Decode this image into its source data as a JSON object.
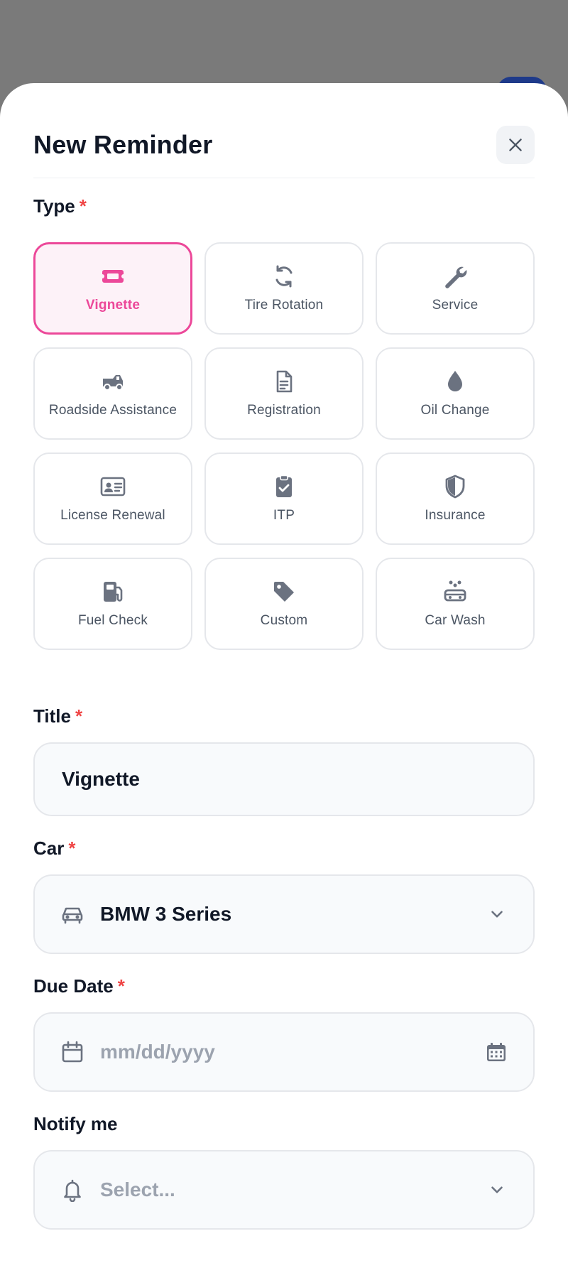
{
  "modal": {
    "title": "New Reminder"
  },
  "type_section": {
    "label": "Type",
    "required_mark": "*",
    "options": [
      {
        "label": "Vignette",
        "icon": "ticket-icon",
        "selected": true
      },
      {
        "label": "Tire Rotation",
        "icon": "rotate-icon",
        "selected": false
      },
      {
        "label": "Service",
        "icon": "wrench-icon",
        "selected": false
      },
      {
        "label": "Roadside Assistance",
        "icon": "tow-truck-icon",
        "selected": false
      },
      {
        "label": "Registration",
        "icon": "document-icon",
        "selected": false
      },
      {
        "label": "Oil Change",
        "icon": "droplet-icon",
        "selected": false
      },
      {
        "label": "License Renewal",
        "icon": "id-card-icon",
        "selected": false
      },
      {
        "label": "ITP",
        "icon": "clipboard-check-icon",
        "selected": false
      },
      {
        "label": "Insurance",
        "icon": "shield-icon",
        "selected": false
      },
      {
        "label": "Fuel Check",
        "icon": "fuel-pump-icon",
        "selected": false
      },
      {
        "label": "Custom",
        "icon": "tag-icon",
        "selected": false
      },
      {
        "label": "Car Wash",
        "icon": "car-wash-icon",
        "selected": false
      }
    ]
  },
  "title_field": {
    "label": "Title",
    "required_mark": "*",
    "value": "Vignette"
  },
  "car_field": {
    "label": "Car",
    "required_mark": "*",
    "value": "BMW 3 Series",
    "icon": "car-icon"
  },
  "due_date_field": {
    "label": "Due Date",
    "required_mark": "*",
    "placeholder": "mm/dd/yyyy",
    "icon": "calendar-icon"
  },
  "notify_field": {
    "label": "Notify me",
    "placeholder": "Select...",
    "icon": "bell-icon"
  },
  "colors": {
    "accent": "#ec4899",
    "accent_bg": "#fdf2f8",
    "required": "#ef4444",
    "text": "#111827",
    "muted": "#6b7280"
  }
}
